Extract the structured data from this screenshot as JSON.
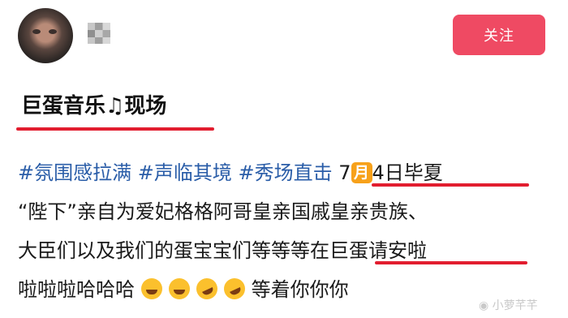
{
  "header": {
    "follow_label": "关注"
  },
  "post": {
    "title_text": "巨蛋音乐",
    "title_suffix": "现场",
    "line1": {
      "tags": [
        "#氛围感拉满",
        "#声临其境",
        "#秀场直击"
      ],
      "date_pre": "7",
      "month_box": "月",
      "date_post": "4日毕夏"
    },
    "line2": "“陛下”亲自为爱妃格格阿哥皇亲国戚皇亲贵族、",
    "line3": "大臣们以及我们的蛋宝宝们等等等在巨蛋请安啦",
    "line4_text": "啦啦啦哈哈哈",
    "line4_end": "等着你你你"
  },
  "watermark": "小萝芊芊",
  "colors": {
    "accent": "#ef4a63",
    "hashtag": "#2a5da8",
    "underline": "#e21d2f"
  },
  "icons": [
    "music-note-icon",
    "laugh-cry-emoji",
    "rofl-emoji",
    "weibo-logo"
  ]
}
